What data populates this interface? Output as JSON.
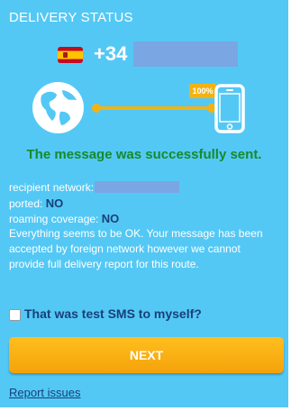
{
  "header": {
    "title": "DELIVERY STATUS"
  },
  "recipient": {
    "prefix": "+34"
  },
  "diagram": {
    "progress_label": "100%"
  },
  "status": {
    "message": "The message was successfully sent."
  },
  "details": {
    "network_label": "recipient network:",
    "ported_label": "ported:",
    "ported_value": "NO",
    "roaming_label": "roaming coverage:",
    "roaming_value": "NO",
    "note_line1": "Everything seems to be OK. Your message has been",
    "note_line2": "accepted by foreign network however we cannot",
    "note_line3": "provide full delivery report for this route."
  },
  "test_sms": {
    "label": "That was test SMS to myself?",
    "checked": false
  },
  "actions": {
    "next_label": "NEXT",
    "report_label": "Report issues"
  },
  "colors": {
    "panel": "#54c8f5",
    "accent_orange": "#f2b312",
    "success_green": "#158b2c",
    "dark_blue": "#174079"
  }
}
